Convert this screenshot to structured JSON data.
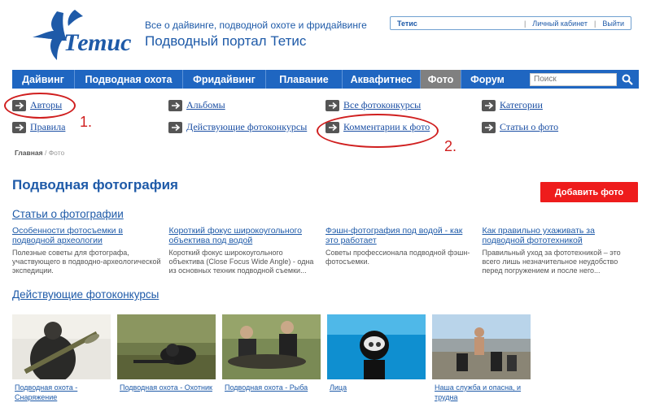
{
  "header": {
    "logo_text": "Тетис",
    "tagline": "Все о дайвинге, подводной охоте и фридайвинге",
    "portal_title": "Подводный портал Тетис",
    "user_name": "Тетис",
    "cabinet_link": "Личный кабинет",
    "logout_link": "Выйти"
  },
  "nav": {
    "items": [
      {
        "label": "Дайвинг",
        "active": false
      },
      {
        "label": "Подводная охота",
        "active": false
      },
      {
        "label": "Фридайвинг",
        "active": false
      },
      {
        "label": "Плавание",
        "active": false
      },
      {
        "label": "Аквафитнес",
        "active": false
      },
      {
        "label": "Фото",
        "active": true
      },
      {
        "label": "Форум",
        "active": false
      }
    ],
    "search_placeholder": "Поиск"
  },
  "subnav": {
    "authors": "Авторы",
    "rules": "Правила",
    "albums": "Альбомы",
    "active_contests": "Действующие фотоконкурсы",
    "all_contests": "Все фотоконкурсы",
    "comments": "Комментарии к фото",
    "categories": "Категории",
    "photo_articles": "Статьи о фото"
  },
  "annotations": {
    "first": "1.",
    "second": "2."
  },
  "breadcrumb": {
    "home": "Главная",
    "separator": "/",
    "current": "Фото"
  },
  "main": {
    "title": "Подводная фотография",
    "add_button": "Добавить фото",
    "articles_heading": "Статьи о фотографии",
    "articles": [
      {
        "title": "Особенности фотосъемки в подводной археологии",
        "desc": "Полезные советы для фотографа, участвующего в подводно-археологической экспедиции."
      },
      {
        "title": "Короткий фокус широкоугольного объектива под водой",
        "desc": "Короткий фокус широкоугольного объектива (Close Focus Wide Angle) - одна из основных техник подводной съемки..."
      },
      {
        "title": "Фэшн-фотография под водой - как это работает",
        "desc": "Советы профессионала подводной фэшн-фотосъемки."
      },
      {
        "title": "Как правильно ухаживать за подводной фототехникой",
        "desc": "Правильный уход за фототехникой – это всего лишь незначительное неудобство перед погружением и после него..."
      }
    ],
    "contests_heading": "Действующие фотоконкурсы",
    "contests": [
      {
        "caption": "Подводная охота - Снаряжение"
      },
      {
        "caption": "Подводная охота - Охотник"
      },
      {
        "caption": "Подводная охота - Рыба"
      },
      {
        "caption": "Лица"
      },
      {
        "caption": "Наша служба и опасна, и трудна"
      }
    ]
  },
  "colors": {
    "brand_blue": "#1f66c1",
    "accent_red": "#ee1c1c",
    "annotation_red": "#d01f1f"
  }
}
